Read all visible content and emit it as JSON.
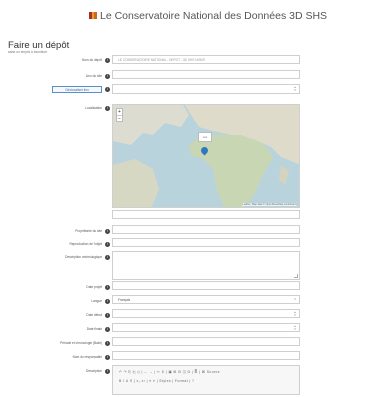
{
  "header": {
    "site_title": "Le Conservatoire National des Données 3D SHS",
    "logo_colors": [
      "#b02a2a",
      "#e0a21b",
      "#d4632a"
    ]
  },
  "page": {
    "title": "Faire un dépôt",
    "subtitle": "saisir un emploi à fourniture"
  },
  "form": {
    "depot_label": "Nom du dépôt",
    "depot_value": "LE CONSERVATOIRE NATIONAL - DEPOT - 3D SHS NOMS",
    "lieu_label": "Lieu du site",
    "geo_button": "Géolocaliser lieu",
    "localisation_label": "Localisation",
    "map_popup": "xxx",
    "map_attribution": "Leaflet | Map data © OpenStreetMap contributors",
    "proprietaire_label": "Propriétaire du site",
    "reproduction_label": "Reproduction de l'objet",
    "description_label": "Description archéologique",
    "date_label": "Date projet",
    "langue_label": "Langue",
    "langue_value": "Français",
    "date_debut_label": "Date début",
    "date_fin_label": "Date finale",
    "periode_label": "Période et chronologie (Baliz)",
    "nom_responsable_label": "Nom du responsable",
    "description2_label": "Description",
    "toolbar_row1": "↶ ↷ ⎘ ⎗ ⎙ | ← → | ✂ ⚲ | ▣ ⊞ ⊟ ◫ Ω | ≣ | ⌘ Source",
    "toolbar_row2": "B I U S | x₂ x² | ≡ ≡ | Styles | Format | ?"
  }
}
